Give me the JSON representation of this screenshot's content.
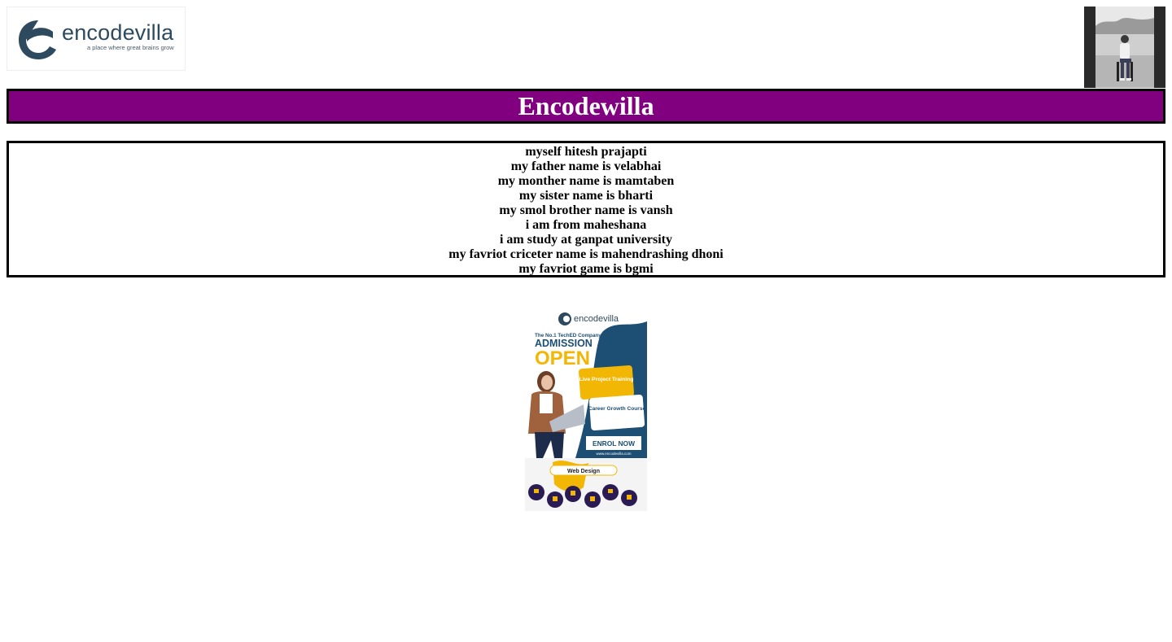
{
  "logo": {
    "brand": "encodevilla",
    "tagline": "a place where great brains grow"
  },
  "title": "Encodewilla",
  "bio_lines": [
    "myself hitesh prajapti",
    "my father name is velabhai",
    "my monther name is mamtaben",
    "my sister name is bharti",
    "my smol brother name is vansh",
    "i am from maheshana",
    "i am study at ganpat university",
    "my favriot criceter name is mahendrashing dhoni",
    "my favriot game is bgmi"
  ],
  "poster": {
    "brand": "encodevilla",
    "kicker": "The No.1 TechED Company",
    "headline_1": "ADMISSION",
    "headline_2": "OPEN",
    "card_1": "Live Project Training",
    "card_2": "Career Growth Course",
    "cta": "ENROL NOW",
    "website": "www.encodevilla.com",
    "section": "Web Design"
  },
  "colors": {
    "title_bg": "#800080",
    "title_text": "#ffffff",
    "poster_navy": "#1d4e73",
    "poster_yellow": "#f2b705",
    "poster_purple": "#2b1b55"
  }
}
